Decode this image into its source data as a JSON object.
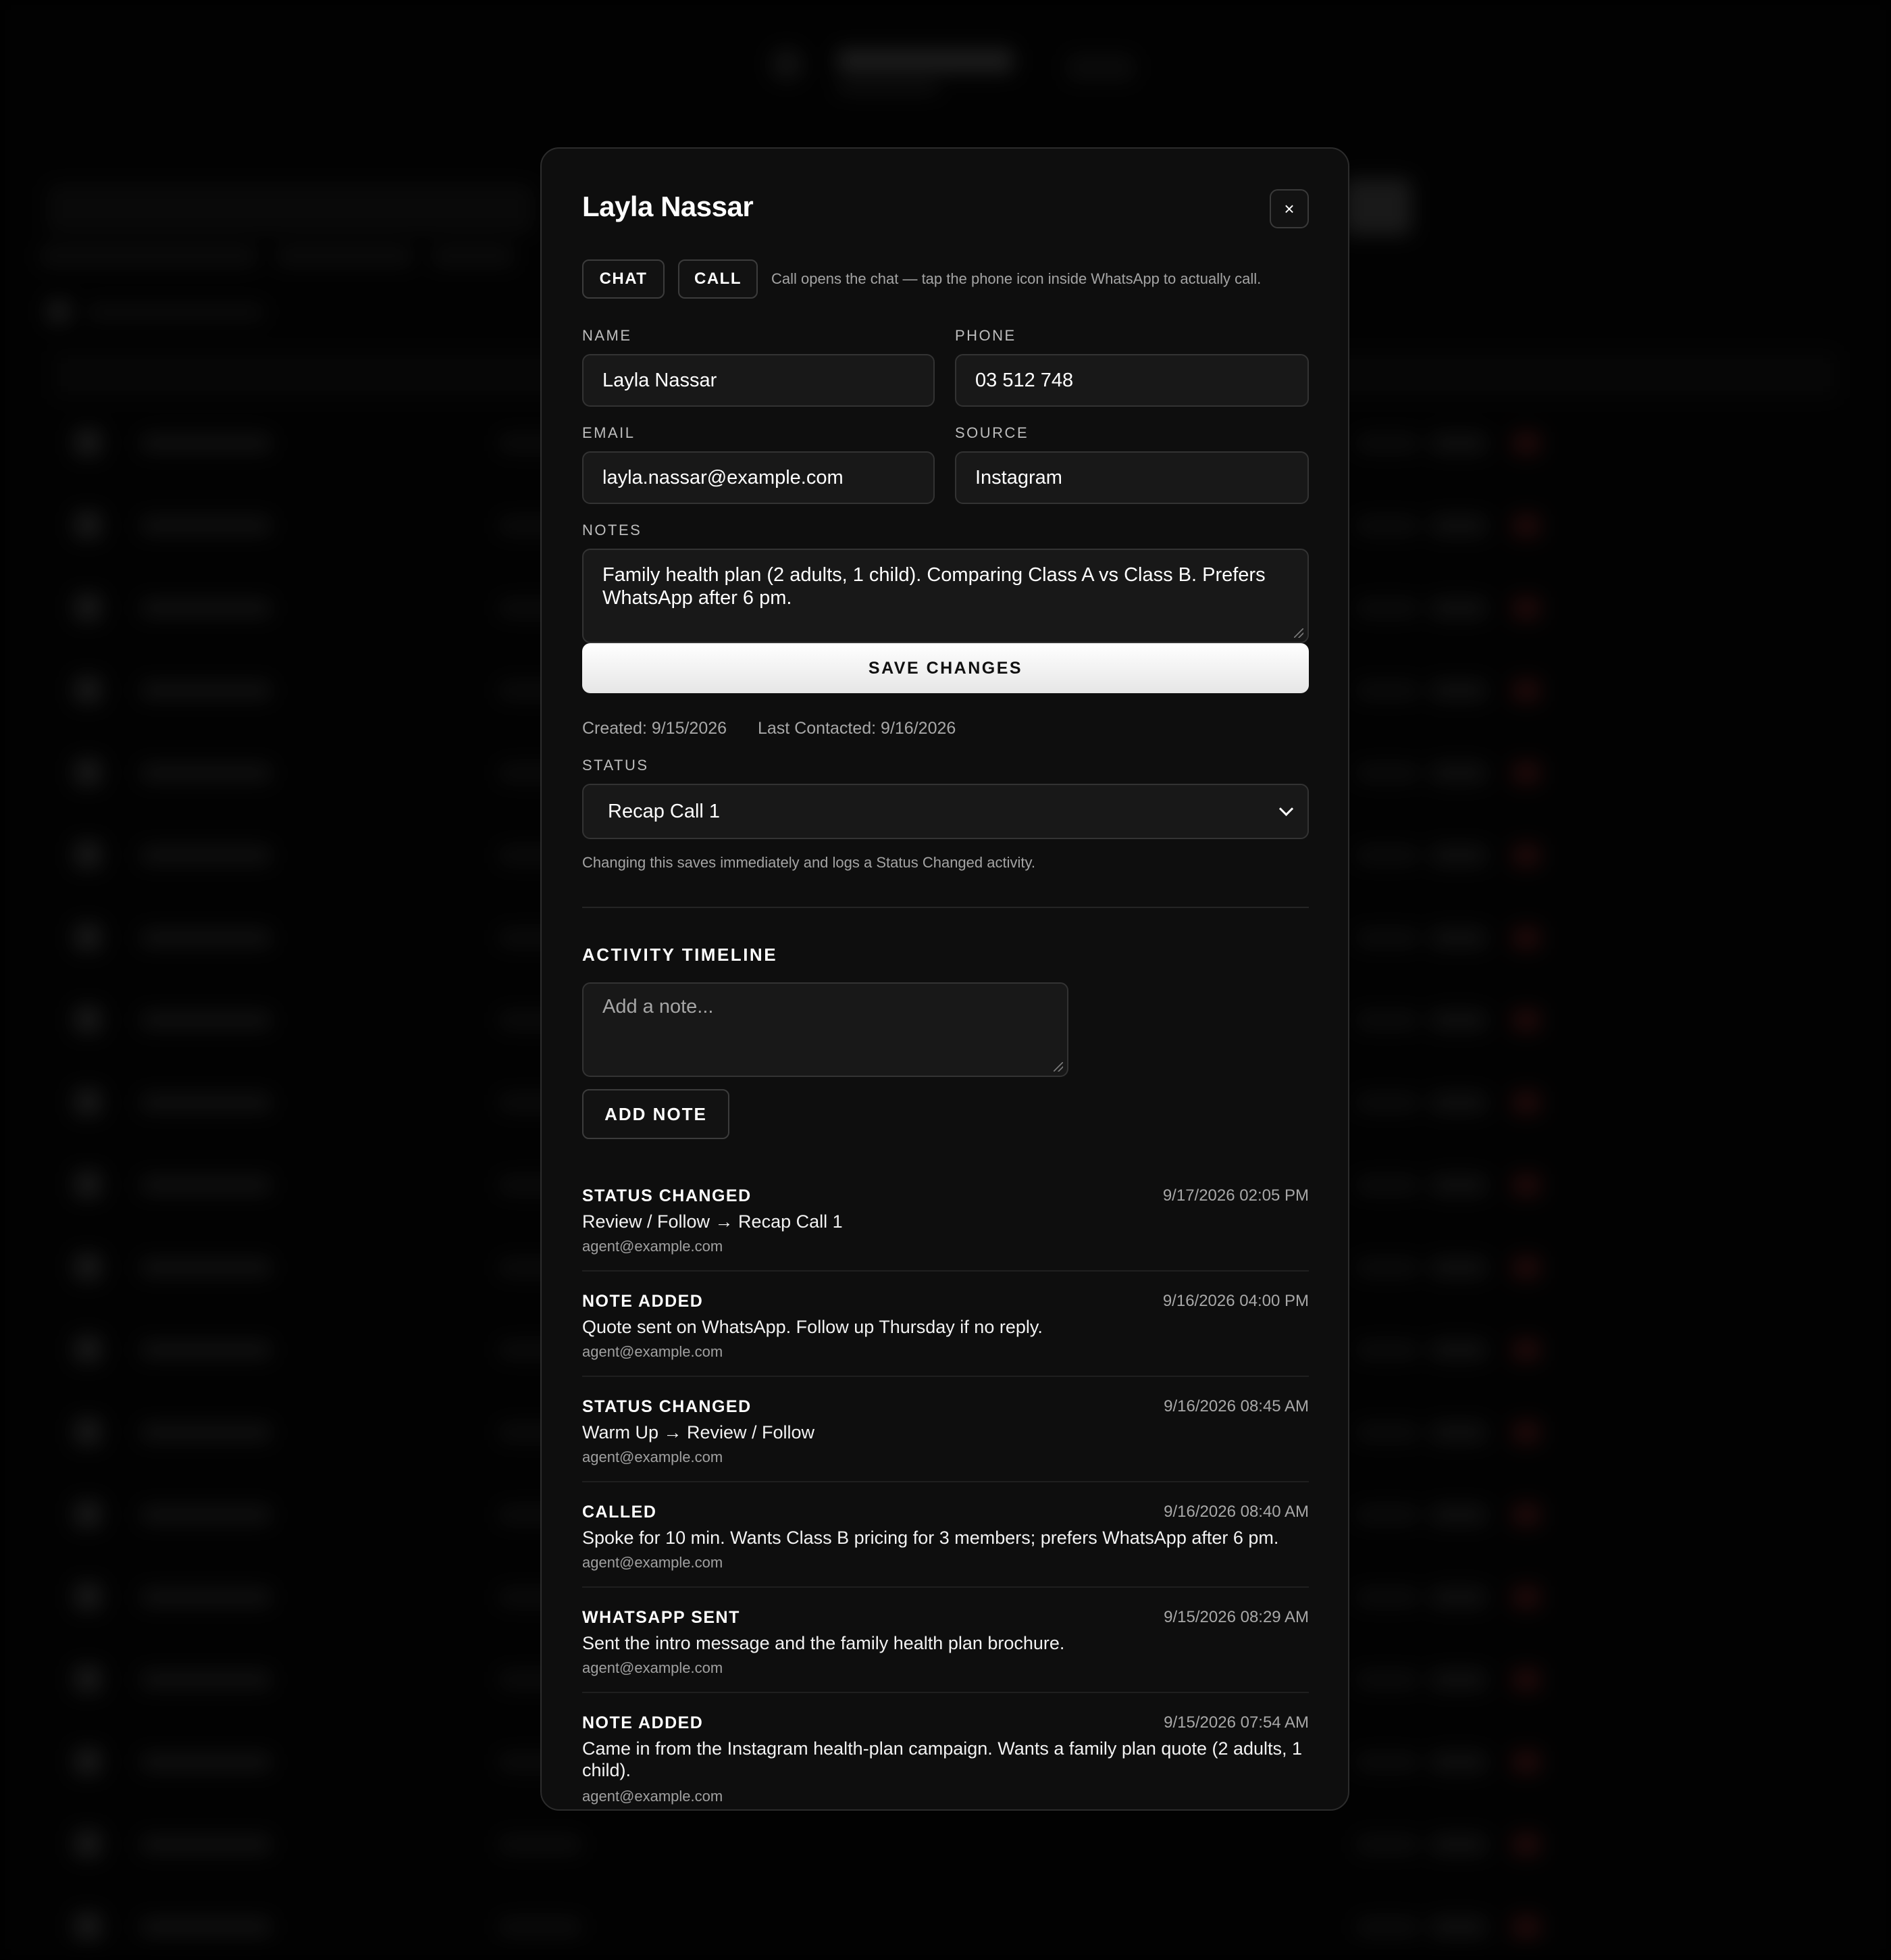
{
  "modal": {
    "title": "Layla Nassar",
    "close_glyph": "×",
    "close_icon": "close-icon",
    "chat_label": "CHAT",
    "call_label": "CALL",
    "call_hint": "Call opens the chat — tap the phone icon inside WhatsApp to actually call."
  },
  "form": {
    "name_label": "NAME",
    "name_value": "Layla Nassar",
    "phone_label": "PHONE",
    "phone_value": "03 512 748",
    "email_label": "EMAIL",
    "email_value": "layla.nassar@example.com",
    "source_label": "SOURCE",
    "source_value": "Instagram",
    "notes_label": "NOTES",
    "notes_value": "Family health plan (2 adults, 1 child). Comparing Class A vs Class B. Prefers WhatsApp after 6 pm.",
    "save_label": "SAVE CHANGES"
  },
  "meta": {
    "created": "Created: 9/15/2026",
    "last_contacted": "Last Contacted: 9/16/2026"
  },
  "status": {
    "label": "STATUS",
    "selected": "Recap Call 1",
    "help": "Changing this saves immediately and logs a Status Changed activity."
  },
  "timeline": {
    "title": "ACTIVITY TIMELINE",
    "note_placeholder": "Add a note...",
    "add_note_label": "ADD NOTE",
    "items": [
      {
        "type": "STATUS CHANGED",
        "time": "9/17/2026 02:05 PM",
        "desc": "Review / Follow → Recap Call 1",
        "agent": "agent@example.com"
      },
      {
        "type": "NOTE ADDED",
        "time": "9/16/2026 04:00 PM",
        "desc": "Quote sent on WhatsApp. Follow up Thursday if no reply.",
        "agent": "agent@example.com"
      },
      {
        "type": "STATUS CHANGED",
        "time": "9/16/2026 08:45 AM",
        "desc": "Warm Up → Review / Follow",
        "agent": "agent@example.com"
      },
      {
        "type": "CALLED",
        "time": "9/16/2026 08:40 AM",
        "desc": "Spoke for 10 min. Wants Class B pricing for 3 members; prefers WhatsApp after 6 pm.",
        "agent": "agent@example.com"
      },
      {
        "type": "WHATSAPP SENT",
        "time": "9/15/2026 08:29 AM",
        "desc": "Sent the intro message and the family health plan brochure.",
        "agent": "agent@example.com"
      },
      {
        "type": "NOTE ADDED",
        "time": "9/15/2026 07:54 AM",
        "desc": "Came in from the Instagram health-plan campaign. Wants a family plan quote (2 adults, 1 child).",
        "agent": "agent@example.com"
      }
    ]
  },
  "colors": {
    "background": "#000000",
    "modal_bg": "#0e0e0e",
    "input_bg": "#181818",
    "accent_button": "#ffffff",
    "muted_text": "#a8a8a8"
  }
}
